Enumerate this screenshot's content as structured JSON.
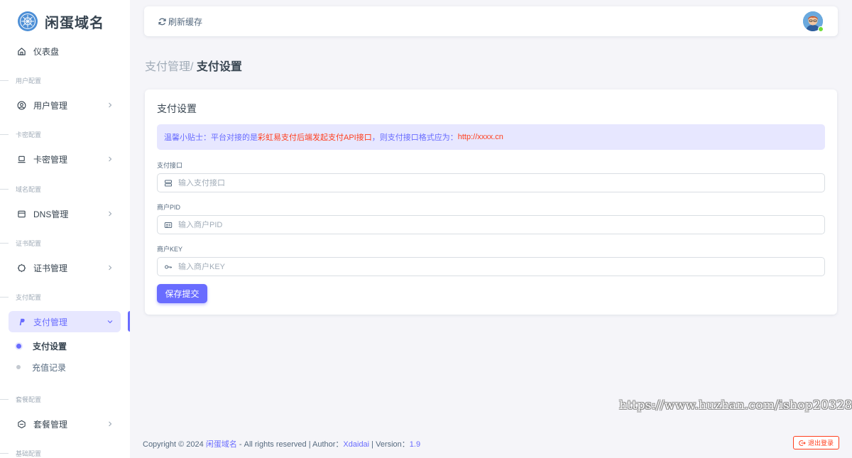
{
  "brand": {
    "name": "闲蛋域名"
  },
  "sidebar": {
    "dashboard": "仪表盘",
    "sections": {
      "user": "用户配置",
      "card": "卡密配置",
      "domain": "域名配置",
      "cert": "证书配置",
      "pay": "支付配置",
      "plan": "套餐配置",
      "base": "基础配置"
    },
    "items": {
      "user": "用户管理",
      "card": "卡密管理",
      "dns": "DNS管理",
      "cert": "证书管理",
      "pay": "支付管理",
      "plan": "套餐管理"
    },
    "pay_sub": {
      "settings": "支付设置",
      "recharge": "充值记录"
    }
  },
  "navbar": {
    "refresh": "刷新缓存"
  },
  "breadcrumb": {
    "parent": "支付管理/",
    "current": "支付设置"
  },
  "card": {
    "title": "支付设置",
    "alert": {
      "prefix": "温馨小贴士：平台对接的是",
      "highlight": "彩虹易支付后端发起支付API接口",
      "middle": "，则支付接口格式应为：",
      "url": "http://xxxx.cn"
    },
    "fields": {
      "api": {
        "label": "支付接口",
        "placeholder": "输入支付接口"
      },
      "pid": {
        "label": "商户PID",
        "placeholder": "输入商户PID"
      },
      "key": {
        "label": "商户KEY",
        "placeholder": "输入商户KEY"
      }
    },
    "submit": "保存提交"
  },
  "watermark": "https://www.huzhan.com/ishop20328",
  "footer": {
    "prefix": "Copyright © 2024 ",
    "site": "闲蛋域名",
    "rights": " - All rights reserved | Author：",
    "author": "Xdaidai",
    "version_label": " | Version：",
    "version": "1.9"
  },
  "logout": "退出登录",
  "colors": {
    "primary": "#696cff",
    "danger": "#ff3e1d",
    "background": "#f5f5f9"
  }
}
